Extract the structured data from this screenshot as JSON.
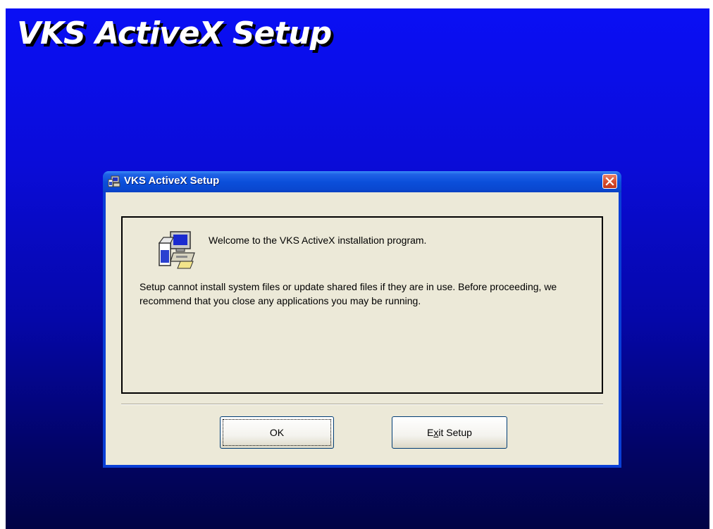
{
  "banner": {
    "title": "VKS ActiveX Setup"
  },
  "dialog": {
    "title": "VKS ActiveX Setup",
    "title_icon": "setup-computer-icon",
    "close_icon": "close-icon",
    "welcome_text": "Welcome to the VKS ActiveX installation program.",
    "message": "Setup cannot install system files or update shared files if they are in use. Before proceeding, we recommend that you close any applications you may be running.",
    "setup_icon": "setup-computer-icon"
  },
  "buttons": {
    "ok_label": "OK",
    "exit_prefix": "E",
    "exit_hotkey": "x",
    "exit_suffix": "it Setup"
  },
  "colors": {
    "background_top": "#0a0ff5",
    "background_bottom": "#010345",
    "titlebar": "#0b4fdb",
    "dialog_face": "#ece9d8",
    "close_button": "#d9502e"
  }
}
